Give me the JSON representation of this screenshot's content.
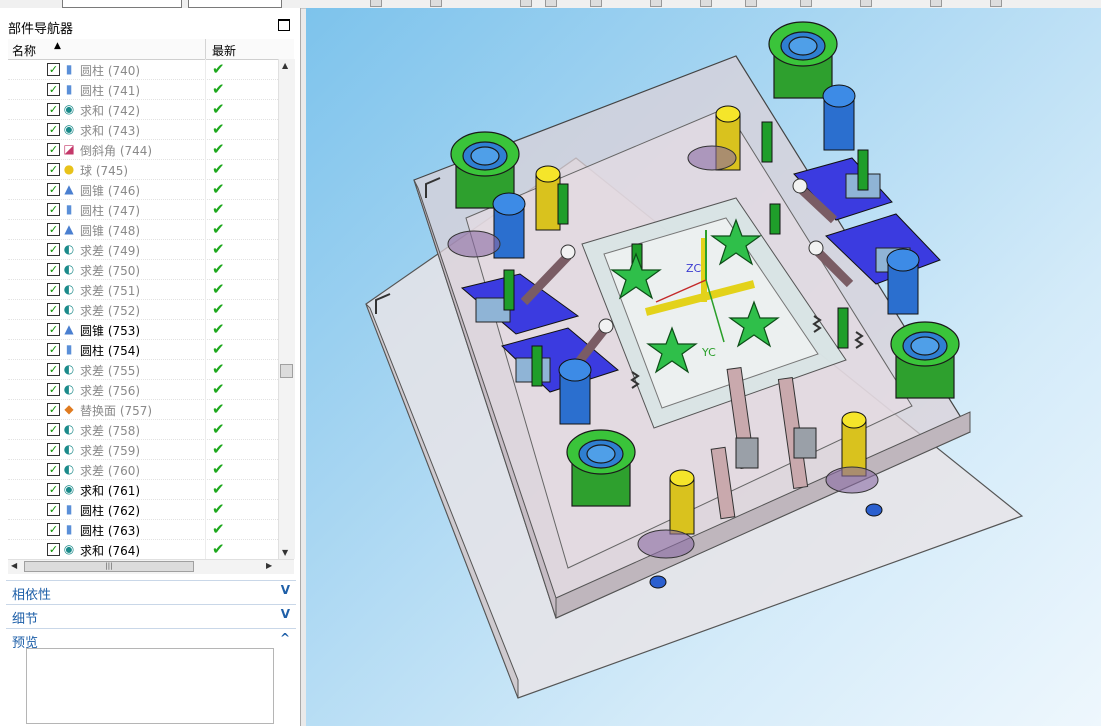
{
  "part_navigator": {
    "title": "部件导航器",
    "col_name": "名称",
    "col_latest": "最新",
    "rows": [
      {
        "label": "圆柱 (740)",
        "icon": "cylinder-icon",
        "style": "dim"
      },
      {
        "label": "圆柱 (741)",
        "icon": "cylinder-icon",
        "style": "dim"
      },
      {
        "label": "求和 (742)",
        "icon": "unite-icon",
        "style": "dim"
      },
      {
        "label": "求和 (743)",
        "icon": "unite-icon",
        "style": "dim"
      },
      {
        "label": "倒斜角 (744)",
        "icon": "chamfer-icon",
        "style": "dim"
      },
      {
        "label": "球 (745)",
        "icon": "sphere-icon",
        "style": "dim"
      },
      {
        "label": "圆锥 (746)",
        "icon": "cone-icon",
        "style": "dim"
      },
      {
        "label": "圆柱 (747)",
        "icon": "cylinder-icon",
        "style": "dim"
      },
      {
        "label": "圆锥 (748)",
        "icon": "cone-icon",
        "style": "dim"
      },
      {
        "label": "求差 (749)",
        "icon": "subtract-icon",
        "style": "dim"
      },
      {
        "label": "求差 (750)",
        "icon": "subtract-icon",
        "style": "dim"
      },
      {
        "label": "求差 (751)",
        "icon": "subtract-icon",
        "style": "dim"
      },
      {
        "label": "求差 (752)",
        "icon": "subtract-icon",
        "style": "dim"
      },
      {
        "label": "圆锥 (753)",
        "icon": "cone-icon",
        "style": "bold"
      },
      {
        "label": "圆柱 (754)",
        "icon": "cylinder-icon",
        "style": "bold"
      },
      {
        "label": "求差 (755)",
        "icon": "subtract-icon",
        "style": "dim"
      },
      {
        "label": "求差 (756)",
        "icon": "subtract-icon",
        "style": "dim"
      },
      {
        "label": "替换面 (757)",
        "icon": "replace-face-icon",
        "style": "dim"
      },
      {
        "label": "求差 (758)",
        "icon": "subtract-icon",
        "style": "dim"
      },
      {
        "label": "求差 (759)",
        "icon": "subtract-icon",
        "style": "dim"
      },
      {
        "label": "求差 (760)",
        "icon": "subtract-icon",
        "style": "dim"
      },
      {
        "label": "求和 (761)",
        "icon": "unite-icon",
        "style": "bold"
      },
      {
        "label": "圆柱 (762)",
        "icon": "cylinder-icon",
        "style": "bold"
      },
      {
        "label": "圆柱 (763)",
        "icon": "cylinder-icon",
        "style": "bold"
      },
      {
        "label": "求和 (764)",
        "icon": "unite-icon",
        "style": "bold"
      }
    ]
  },
  "sections": {
    "dependencies": "相依性",
    "details": "细节",
    "preview": "预览"
  },
  "viewport": {
    "axis_z": "ZC",
    "axis_y": "YC"
  },
  "colors": {
    "accent": "#1e5fa8",
    "check_green": "#1da81d",
    "viewport_bg": "#a8d6f2"
  }
}
